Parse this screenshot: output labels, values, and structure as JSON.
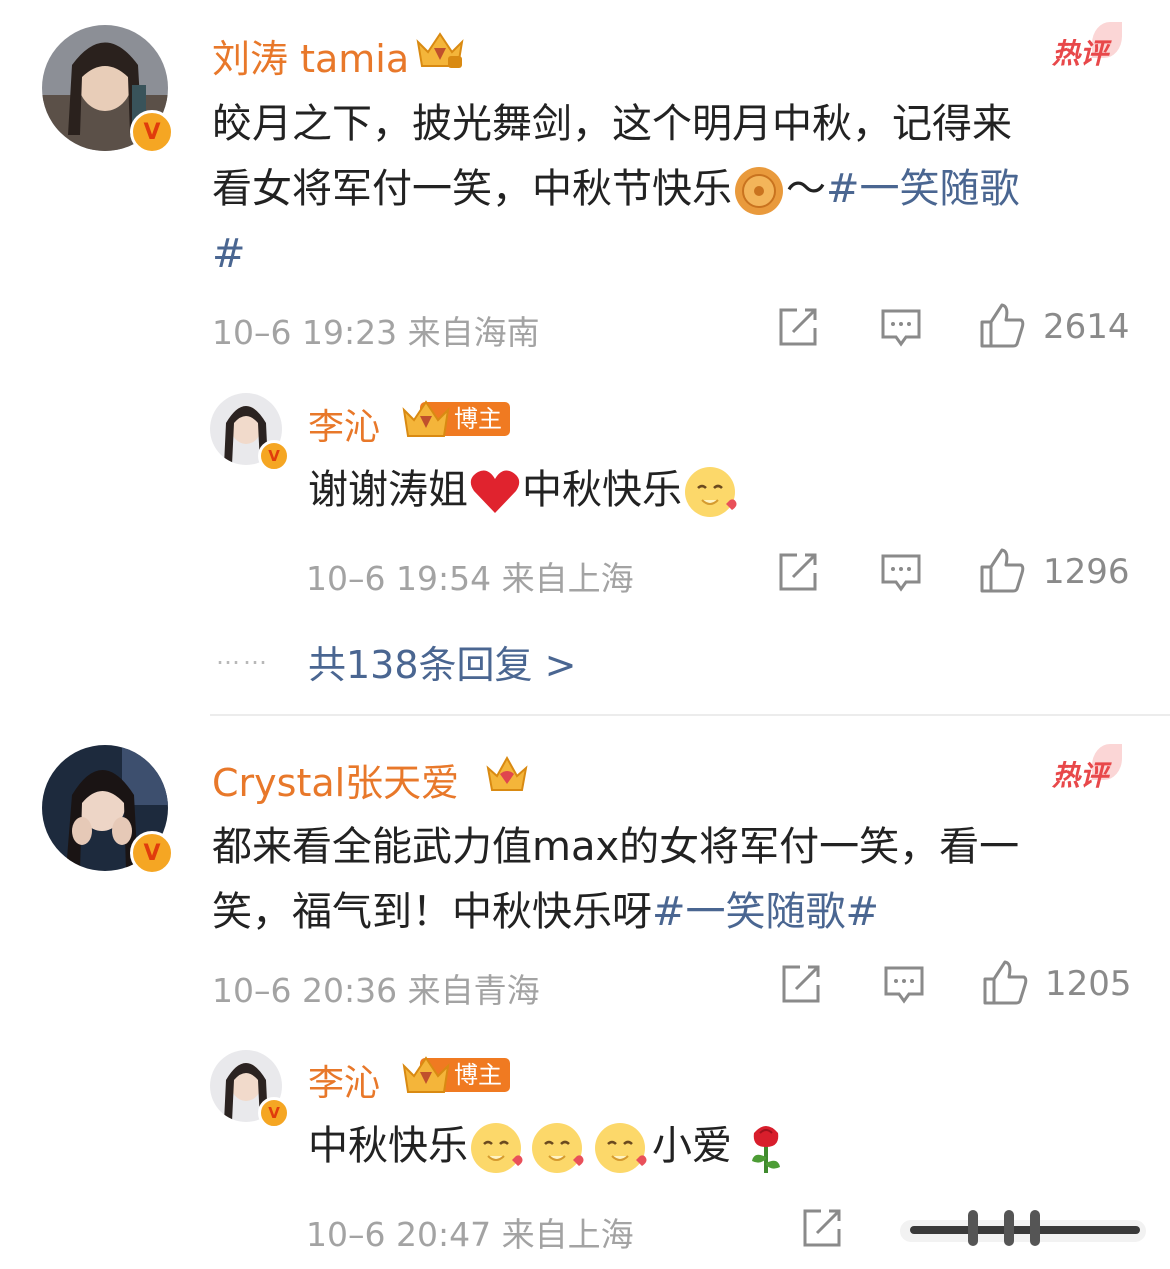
{
  "comments": [
    {
      "author": "刘涛 tamia",
      "hot_label": "热评",
      "text_part1": "皎月之下，披光舞剑，这个明月中秋，记得来",
      "text_part2a": "看女将军付一笑，中秋节快乐",
      "text_part2b": "～",
      "hashtag_a": "#一笑随歌",
      "hashtag_b": "#",
      "meta": "10–6 19:23  来自海南",
      "likes": "2614",
      "reply": {
        "author": "李沁",
        "tag": "博主",
        "text_a": "谢谢涛姐",
        "text_b": "中秋快乐",
        "meta": "10–6 19:54  来自上海",
        "likes": "1296"
      },
      "more_replies": "共138条回复 >",
      "dots": "……"
    },
    {
      "author": "Crystal张天爱",
      "hot_label": "热评",
      "text_part1": "都来看全能武力值max的女将军付一笑，看一",
      "text_part2": "笑，福气到！中秋快乐呀",
      "hashtag": "#一笑随歌#",
      "meta": "10–6 20:36  来自青海",
      "likes": "1205",
      "reply": {
        "author": "李沁",
        "tag": "博主",
        "text_a": "中秋快乐",
        "text_b": "小爱",
        "meta": "10–6 20:47  来自上海"
      }
    }
  ],
  "colors": {
    "name": "#e8782a",
    "link": "#4a6691",
    "meta": "#a3a3a3",
    "hot": "#e8484a",
    "tag": "#f07a21"
  },
  "icons": [
    "repost-icon",
    "comment-icon",
    "like-icon",
    "crown-badge-icon",
    "verified-badge-icon",
    "mooncake-emoji",
    "heart-emoji",
    "blush-emoji",
    "rose-emoji"
  ]
}
